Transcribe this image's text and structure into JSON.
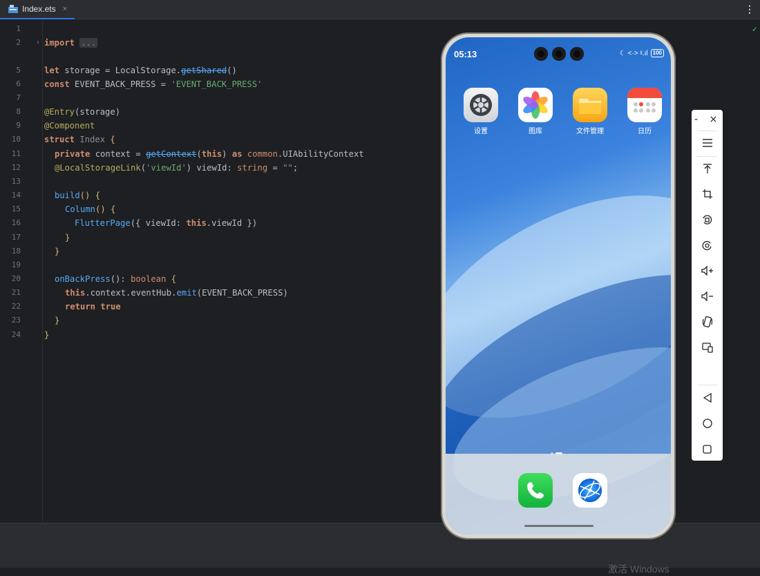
{
  "tab": {
    "filename": "Index.ets",
    "close": "×"
  },
  "toolbar_menu": "⋮",
  "line_numbers": [
    "1",
    "2",
    "5",
    "6",
    "7",
    "8",
    "9",
    "10",
    "11",
    "12",
    "13",
    "14",
    "15",
    "16",
    "17",
    "18",
    "19",
    "20",
    "21",
    "22",
    "23",
    "24"
  ],
  "code": {
    "l2_kw": "import",
    "l2_fold": "...",
    "l5": [
      "let",
      " storage = ",
      "LocalStorage",
      ".",
      "getShared",
      "()"
    ],
    "l6": [
      "const",
      " EVENT_BACK_PRESS = ",
      "'EVENT_BACK_PRESS'"
    ],
    "l8": [
      "@Entry",
      "(storage)"
    ],
    "l9": "@Component",
    "l10": [
      "struct",
      " ",
      "Index",
      " {"
    ],
    "l11": [
      "private",
      " context = ",
      "getContext",
      "(",
      "this",
      ") ",
      "as",
      " ",
      "common",
      ".UIAbilityContext"
    ],
    "l12": [
      "@LocalStorageLink",
      "(",
      "'viewId'",
      ") viewId: ",
      "string",
      " = ",
      "\"\"",
      ";"
    ],
    "l14": [
      "build",
      "() {"
    ],
    "l15": [
      "Column",
      "() {"
    ],
    "l16": [
      "FlutterPage",
      "({ viewId: ",
      "this",
      ".viewId })"
    ],
    "l17": "}",
    "l18": "}",
    "l20": [
      "onBackPress",
      "(): ",
      "boolean",
      " {"
    ],
    "l21": [
      "this",
      ".context.eventHub.",
      "emit",
      "(EVENT_BACK_PRESS)"
    ],
    "l22": [
      "return",
      " ",
      "true"
    ],
    "l23": "}",
    "l24": "}"
  },
  "phone": {
    "time": "05:13",
    "status_icons": "☾ <·> ᵡ.ıl",
    "battery": "100",
    "apps": [
      {
        "label": "设置",
        "icon": "settings-icon"
      },
      {
        "label": "图库",
        "icon": "gallery-icon"
      },
      {
        "label": "文件管理",
        "icon": "files-icon"
      },
      {
        "label": "日历",
        "icon": "calendar-icon"
      }
    ],
    "dock": [
      {
        "icon": "phone-icon"
      },
      {
        "icon": "browser-icon"
      }
    ]
  },
  "emulator_tools": {
    "minimize": "-",
    "close": "×",
    "items": [
      "menu-icon",
      "pin-top-icon",
      "crop-icon",
      "rotate-icon",
      "screenshot-icon",
      "volume-up-icon",
      "volume-down-icon",
      "shake-icon",
      "multi-device-icon",
      "back-icon",
      "home-icon",
      "recents-icon"
    ]
  },
  "watermark": "激活 Windows"
}
